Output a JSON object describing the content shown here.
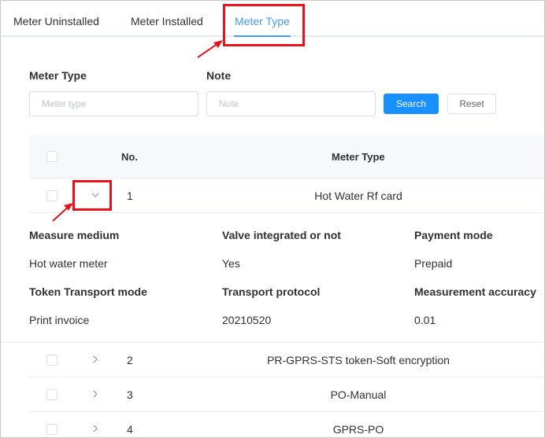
{
  "tabs": [
    {
      "label": "Meter Uninstalled",
      "active": false
    },
    {
      "label": "Meter Installed",
      "active": false
    },
    {
      "label": "Meter Type",
      "active": true
    }
  ],
  "filters": {
    "meter_type": {
      "label": "Meter Type",
      "placeholder": "Meter type",
      "value": ""
    },
    "note": {
      "label": "Note",
      "placeholder": "Note",
      "value": ""
    },
    "search_label": "Search",
    "reset_label": "Reset"
  },
  "table": {
    "headers": {
      "no": "No.",
      "meter_type": "Meter Type"
    },
    "rows": [
      {
        "no": "1",
        "meter_type": "Hot Water Rf card",
        "expanded": true
      },
      {
        "no": "2",
        "meter_type": "PR-GPRS-STS token-Soft encryption",
        "expanded": false
      },
      {
        "no": "3",
        "meter_type": "PO-Manual",
        "expanded": false
      },
      {
        "no": "4",
        "meter_type": "GPRS-PO",
        "expanded": false
      }
    ]
  },
  "details": {
    "measure_medium": {
      "label": "Measure medium",
      "value": "Hot water meter"
    },
    "valve_integrated": {
      "label": "Valve integrated or not",
      "value": "Yes"
    },
    "payment_mode": {
      "label": "Payment mode",
      "value": "Prepaid"
    },
    "token_transport_mode": {
      "label": "Token Transport mode",
      "value": "Print invoice"
    },
    "transport_protocol": {
      "label": "Transport protocol",
      "value": "20210520"
    },
    "measurement_accuracy": {
      "label": "Measurement accuracy",
      "value": "0.01"
    }
  },
  "icons": {
    "collapsed": "chevron-right-icon",
    "expanded": "chevron-down-icon"
  },
  "colors": {
    "accent": "#409eff",
    "primary_button": "#1890ff",
    "annotation": "#e8131a"
  }
}
